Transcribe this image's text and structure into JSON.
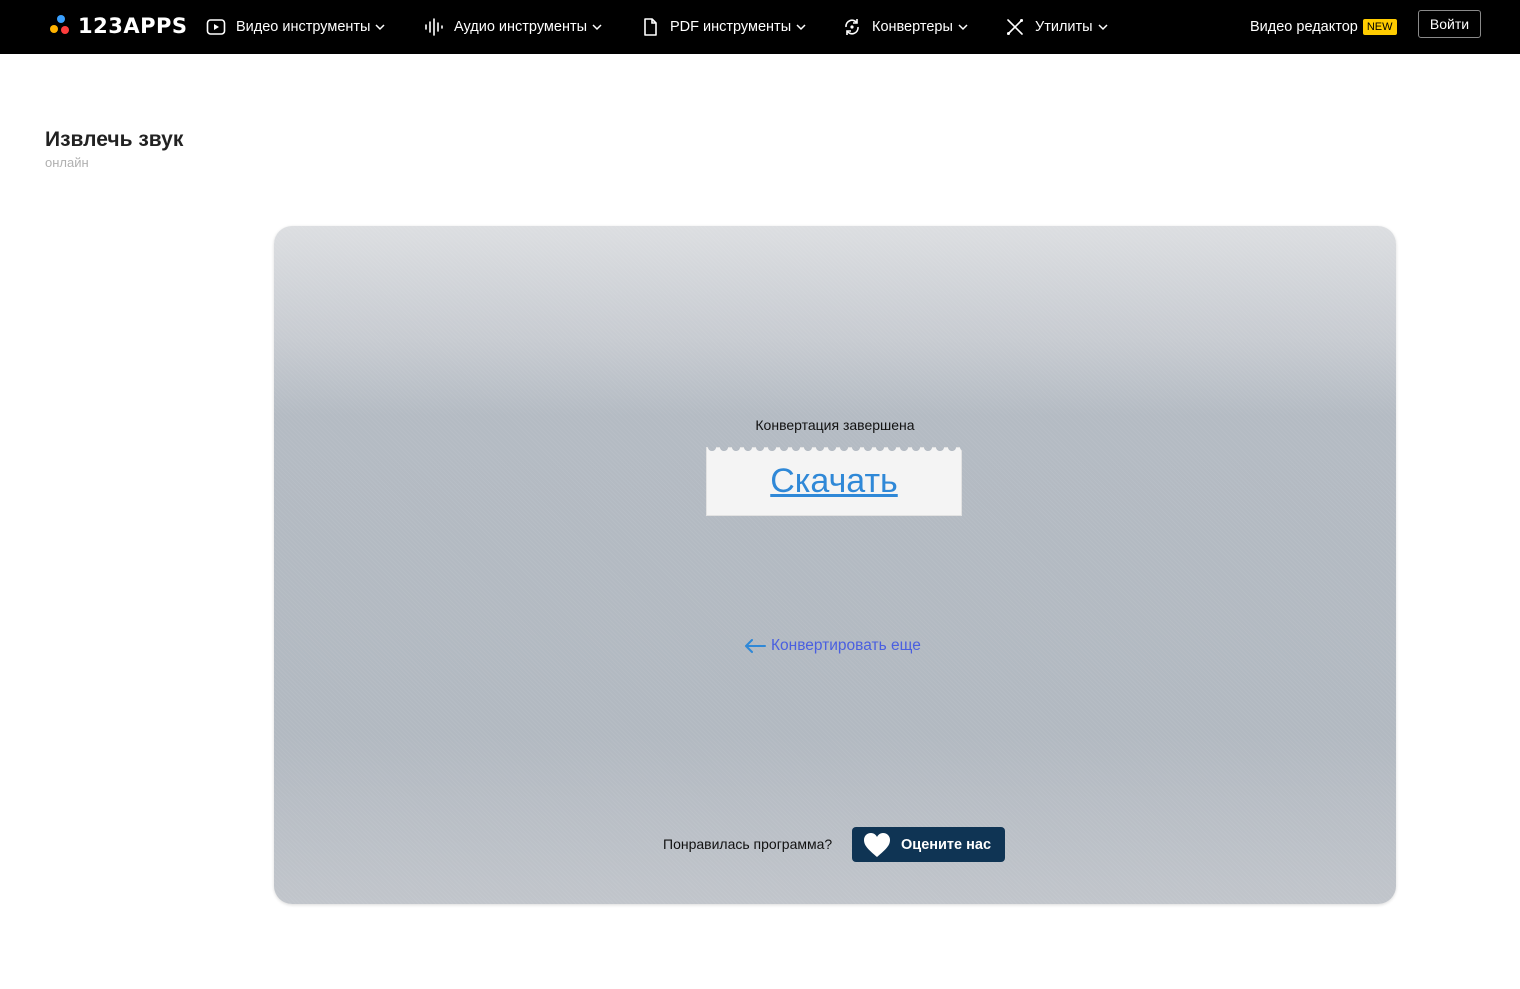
{
  "header": {
    "logo_text": "123APPS",
    "nav": [
      {
        "label": "Видео инструменты",
        "icon": "play-circle-icon"
      },
      {
        "label": "Аудио инструменты",
        "icon": "waveform-icon"
      },
      {
        "label": "PDF инструменты",
        "icon": "document-icon"
      },
      {
        "label": "Конвертеры",
        "icon": "convert-icon"
      },
      {
        "label": "Утилиты",
        "icon": "tools-icon"
      }
    ],
    "editor_label": "Видео редактор",
    "new_badge": "NEW",
    "login_label": "Войти"
  },
  "page": {
    "title": "Извлечь звук",
    "subtitle": "онлайн"
  },
  "result": {
    "status": "Конвертация завершена",
    "download_label": "Скачать",
    "convert_more_label": "Конвертировать еще",
    "rate_question": "Понравилась программа?",
    "rate_button_label": "Оцените нас"
  },
  "colors": {
    "header_bg": "#000000",
    "badge_new": "#ffcc00",
    "download_link": "#2f88d7",
    "back_link": "#4a5fe0",
    "rate_button_bg": "#0f3454"
  }
}
